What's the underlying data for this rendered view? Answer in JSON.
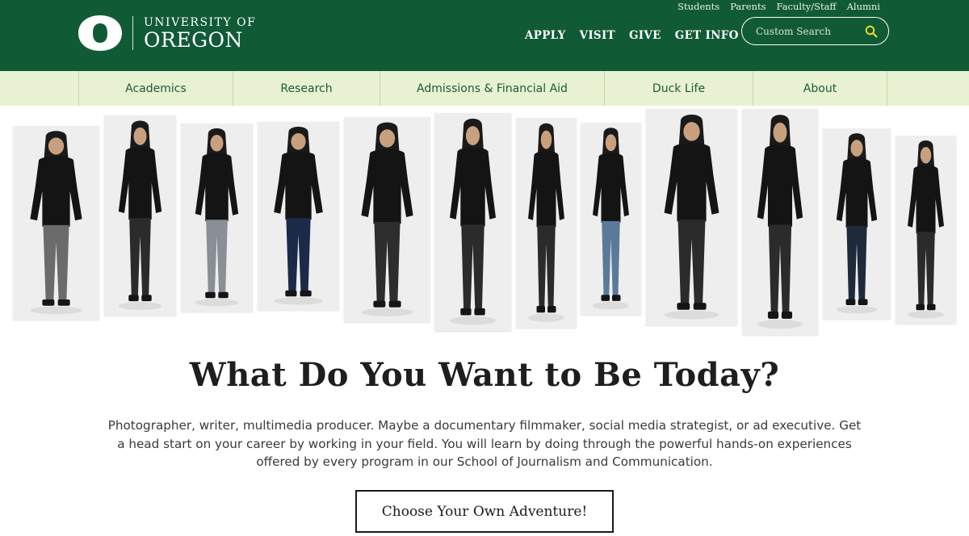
{
  "header": {
    "logo": {
      "line1": "UNIVERSITY OF",
      "line2": "OREGON",
      "mark_icon": "uo-o-mark-icon"
    },
    "utility_links": [
      "Students",
      "Parents",
      "Faculty/Staff",
      "Alumni"
    ],
    "main_links": [
      "APPLY",
      "VISIT",
      "GIVE",
      "GET INFO"
    ],
    "search": {
      "placeholder": "Custom Search",
      "value": "",
      "icon": "search-icon"
    }
  },
  "nav": {
    "items": [
      "Academics",
      "Research",
      "Admissions & Financial Aid",
      "Duck Life",
      "About"
    ]
  },
  "hero": {
    "photo_count": 12,
    "headline": "What Do You Want to Be Today?",
    "body": "Photographer, writer, multimedia producer. Maybe a documentary filmmaker, social media strategist, or ad executive. Get a head start on your career by working in your field. You will learn by doing through the powerful hands-on experiences offered by every program in our School of Journalism and Communication.",
    "cta_label": "Choose Your Own Adventure!"
  },
  "colors": {
    "brand_green": "#115a36",
    "nav_background": "#e9f1d3",
    "brand_yellow": "#fee11a"
  }
}
